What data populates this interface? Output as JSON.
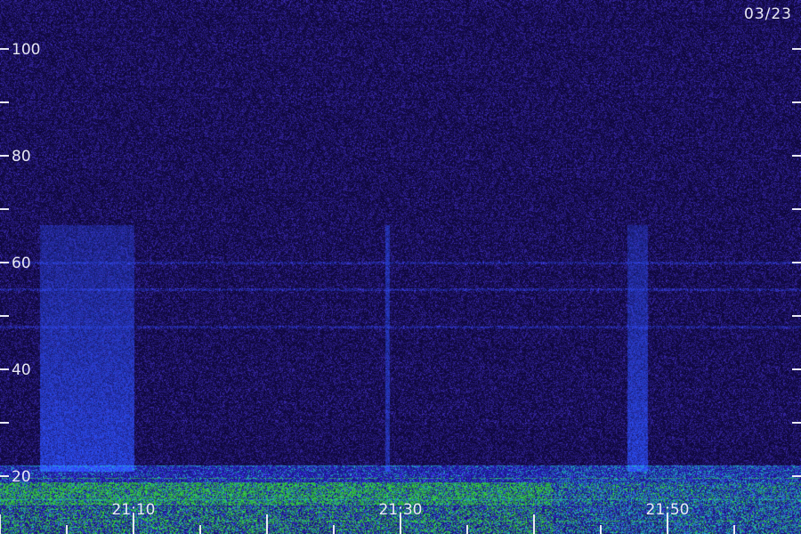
{
  "date_label": "03/23",
  "chart_data": {
    "type": "heatmap",
    "title": "",
    "xlabel": "",
    "ylabel": "",
    "y_ticks": [
      20,
      40,
      60,
      80,
      100
    ],
    "x_ticks": [
      "21:10",
      "21:30",
      "21:50"
    ],
    "colors": {
      "background": "#0d0636",
      "noise": "#3a2aa0",
      "burst": "#2c52ff",
      "band_green": "#38e838",
      "band_cyan": "#22c8d8",
      "text": "#e8e8f4"
    },
    "features": [
      {
        "kind": "broadband-burst",
        "time_start": "21:03",
        "time_end": "21:10",
        "freq_min": 21,
        "freq_max": 67
      },
      {
        "kind": "vertical-line",
        "time": "21:29",
        "freq_min": 21,
        "freq_max": 67
      },
      {
        "kind": "broadband-burst",
        "time_start": "21:47",
        "time_end": "21:48",
        "freq_min": 21,
        "freq_max": 67
      },
      {
        "kind": "horizontal-line",
        "freq": 60
      },
      {
        "kind": "horizontal-line",
        "freq": 55
      },
      {
        "kind": "horizontal-line",
        "freq": 48
      },
      {
        "kind": "low-frequency-band",
        "freq_min": 3,
        "freq_max": 22
      }
    ]
  }
}
